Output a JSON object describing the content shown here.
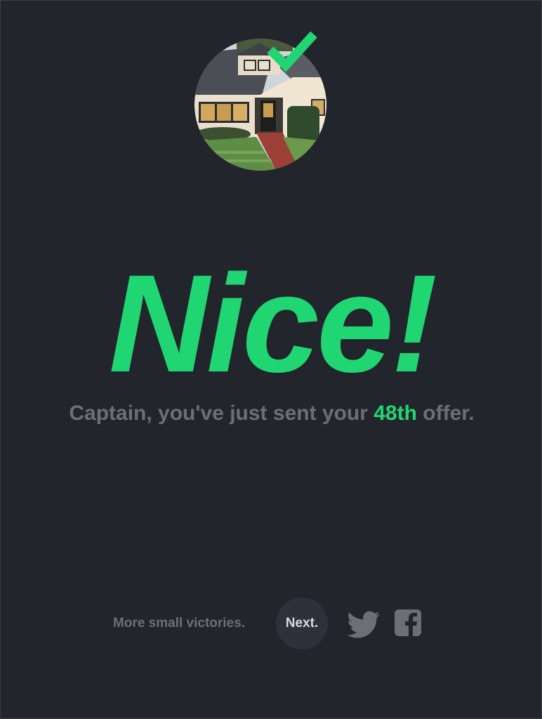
{
  "hero": {
    "image_alt": "house photo",
    "badge_icon": "checkmark-icon"
  },
  "headline": "Nice!",
  "message": {
    "prefix": "Captain, you've just sent your ",
    "count": "48th",
    "suffix": " offer."
  },
  "footer": {
    "tagline": "More small victories.",
    "next_label": "Next.",
    "share_icons": [
      "twitter-icon",
      "facebook-icon"
    ]
  },
  "colors": {
    "background": "#22252c",
    "accent": "#20d672",
    "muted_text": "#6c6f76",
    "button_bg": "#2e3139",
    "icon_gray": "#6c6f76"
  }
}
